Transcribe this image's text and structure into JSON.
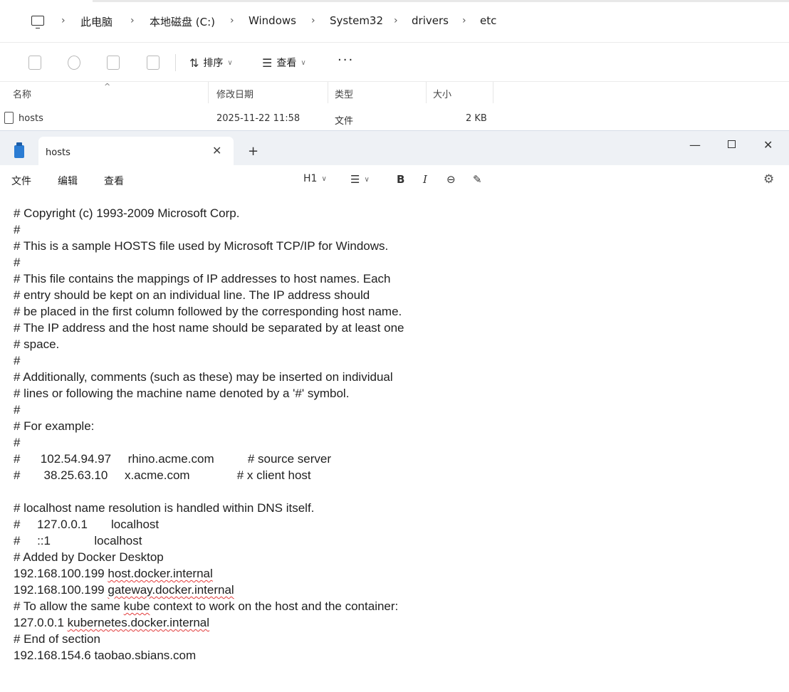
{
  "explorer": {
    "breadcrumb": [
      "此电脑",
      "本地磁盘 (C:)",
      "Windows",
      "System32",
      "drivers",
      "etc"
    ],
    "toolbar": {
      "sort_label": "排序",
      "view_label": "查看",
      "more_label": "···"
    },
    "columns": [
      "名称",
      "修改日期",
      "类型",
      "大小"
    ],
    "file": {
      "name": "hosts",
      "modified": "2025-11-22 11:58",
      "type": "文件",
      "size": "2 KB"
    }
  },
  "notepad": {
    "tab_title": "hosts",
    "menu": [
      "文件",
      "编辑",
      "查看"
    ],
    "format": {
      "heading": "H1",
      "bold": "B",
      "italic": "I"
    },
    "lines": [
      "# Copyright (c) 1993-2009 Microsoft Corp.",
      "#",
      "# This is a sample HOSTS file used by Microsoft TCP/IP for Windows.",
      "#",
      "# This file contains the mappings of IP addresses to host names. Each",
      "# entry should be kept on an individual line. The IP address should",
      "# be placed in the first column followed by the corresponding host name.",
      "# The IP address and the host name should be separated by at least one",
      "# space.",
      "#",
      "# Additionally, comments (such as these) may be inserted on individual",
      "# lines or following the machine name denoted by a '#' symbol.",
      "#",
      "# For example:",
      "#",
      "#      102.54.94.97     rhino.acme.com          # source server",
      "#       38.25.63.10     x.acme.com              # x client host",
      "",
      "# localhost name resolution is handled within DNS itself.",
      "#     127.0.0.1       localhost",
      "#     ::1             localhost",
      "# Added by Docker Desktop",
      "192.168.100.199 host.docker.internal",
      "192.168.100.199 gateway.docker.internal",
      "# To allow the same kube context to work on the host and the container:",
      "127.0.0.1 kubernetes.docker.internal",
      "# End of section",
      "192.168.154.6 taobao.sbians.com"
    ]
  }
}
